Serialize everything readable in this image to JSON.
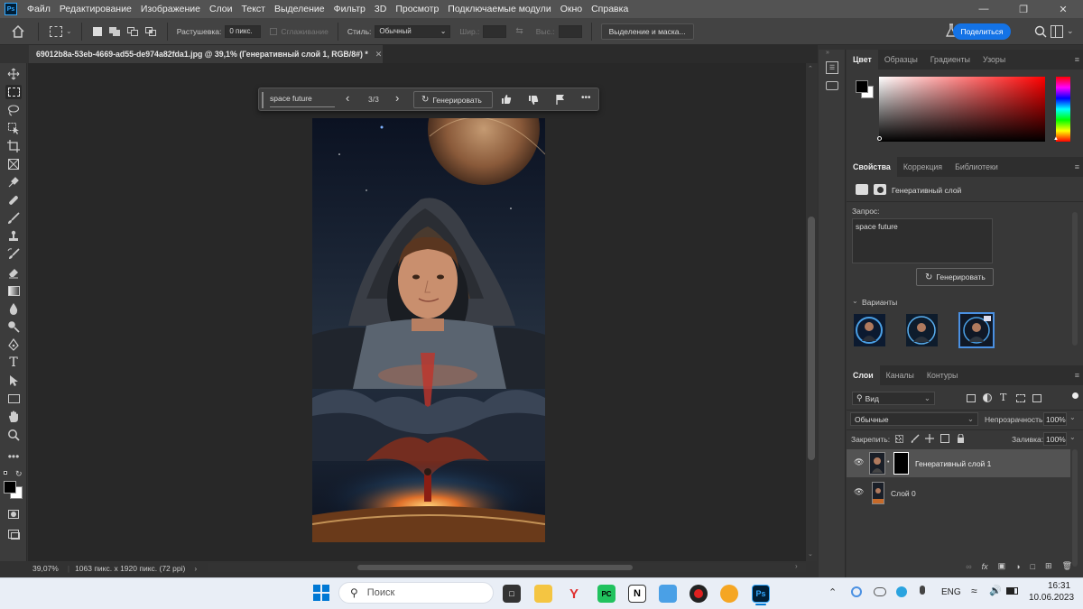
{
  "app": {
    "logo": "Ps"
  },
  "menu": [
    "Файл",
    "Редактирование",
    "Изображение",
    "Слои",
    "Текст",
    "Выделение",
    "Фильтр",
    "3D",
    "Просмотр",
    "Подключаемые модули",
    "Окно",
    "Справка"
  ],
  "options_bar": {
    "feather_label": "Растушевка:",
    "feather_value": "0 пикс.",
    "antialias_label": "Сглаживание",
    "style_label": "Стиль:",
    "style_value": "Обычный",
    "width_label": "Шир.:",
    "height_label": "Выс.:",
    "select_mask_label": "Выделение и маска...",
    "share_label": "Поделиться"
  },
  "document": {
    "tab_title": "69012b8a-53eb-4669-ad55-de974a82fda1.jpg @ 39,1% (Генеративный слой 1, RGB/8#) *",
    "zoom": "39,07%",
    "dimensions": "1063 пикс. x 1920 пикс. (72 ppi)"
  },
  "contextual_bar": {
    "prompt": "space future",
    "variant_counter": "3/3",
    "generate_label": "Генерировать"
  },
  "color_panel": {
    "tabs": [
      "Цвет",
      "Образцы",
      "Градиенты",
      "Узоры"
    ],
    "hue_color": "#ff0000"
  },
  "properties_panel": {
    "tabs": [
      "Свойства",
      "Коррекция",
      "Библиотеки"
    ],
    "layer_type": "Генеративный слой",
    "prompt_label": "Запрос:",
    "prompt_value": "space future",
    "generate_label": "Генерировать",
    "variants_label": "Варианты",
    "variant_count": 3,
    "selected_variant": 3
  },
  "layers_panel": {
    "tabs": [
      "Слои",
      "Каналы",
      "Контуры"
    ],
    "filter_label": "Вид",
    "blend_mode": "Обычные",
    "opacity_label": "Непрозрачность:",
    "opacity_value": "100%",
    "lock_label": "Закрепить:",
    "fill_label": "Заливка:",
    "fill_value": "100%",
    "layers": [
      {
        "name": "Генеративный слой 1",
        "selected": true
      },
      {
        "name": "Слой 0",
        "selected": false
      }
    ]
  },
  "taskbar": {
    "search_placeholder": "Поиск",
    "language": "ENG",
    "time": "16:31",
    "date": "10.06.2023"
  },
  "colors": {
    "accent": "#1473e6",
    "foreground": "#000000",
    "background": "#ffffff"
  }
}
